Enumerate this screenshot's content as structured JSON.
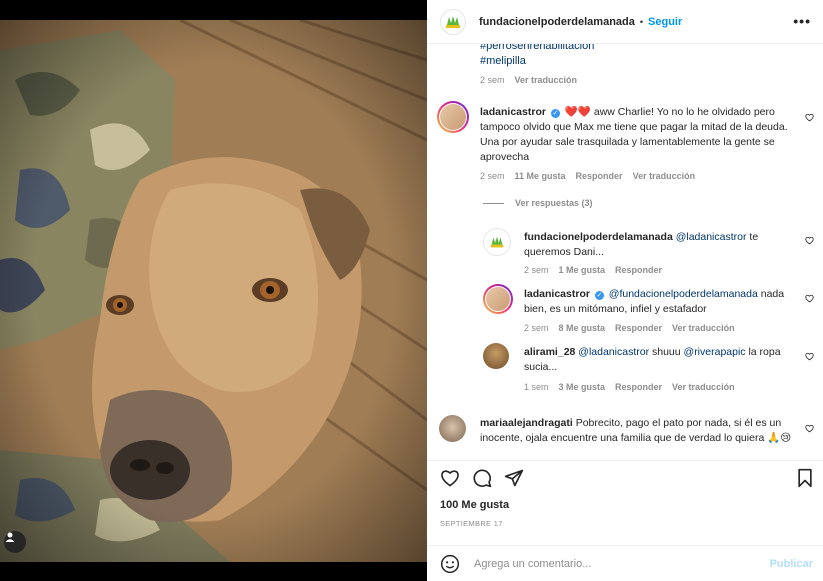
{
  "post": {
    "author": "fundacionelpoderdelamanada",
    "follow_label": "Seguir",
    "separator": "•",
    "more_label": "•••",
    "brand_color": "#5bb53b"
  },
  "caption": {
    "hashtag_1": "#perrosenrehabilitacion",
    "hashtag_2": "#melipilla",
    "time": "2 sem",
    "translate": "Ver traducción"
  },
  "comments": [
    {
      "user": "ladanicastror",
      "verified": true,
      "hearts": "❤️❤️",
      "text": "aww Charlie! Yo no lo he olvidado pero tampoco olvido que Max me tiene que pagar la mitad de la deuda. Una por ayudar sale trasquilada y lamentablemente la gente se aprovecha",
      "time": "2 sem",
      "likes": "11 Me gusta",
      "reply": "Responder",
      "translate": "Ver traducción",
      "view_replies": "Ver respuestas (3)"
    },
    {
      "user": "fundacionelpoderdelamanada",
      "mention": "@ladanicastror",
      "text": "te queremos Dani...",
      "time": "2 sem",
      "likes": "1 Me gusta",
      "reply": "Responder"
    },
    {
      "user": "ladanicastror",
      "verified": true,
      "mention": "@fundacionelpoderdelamanada",
      "text": "nada bien, es un mitómano, infiel y estafador",
      "time": "2 sem",
      "likes": "8 Me gusta",
      "reply": "Responder",
      "translate": "Ver traducción"
    },
    {
      "user": "alirami_28",
      "mention": "@ladanicastror",
      "text_mid": "shuuu",
      "mention_2": "@riverapapic",
      "text": "la ropa sucia...",
      "time": "1 sem",
      "likes": "3 Me gusta",
      "reply": "Responder",
      "translate": "Ver traducción"
    },
    {
      "user": "mariaalejandragati",
      "text": "Pobrecito, pago el pato por nada, si él es un inocente, ojala encuentre una familia que de verdad lo quiera 🙏😢"
    }
  ],
  "actions": {
    "likes": "100 Me gusta",
    "date": "SEPTIEMBRE 17"
  },
  "composer": {
    "placeholder": "Agrega un comentario...",
    "publish": "Publicar"
  }
}
